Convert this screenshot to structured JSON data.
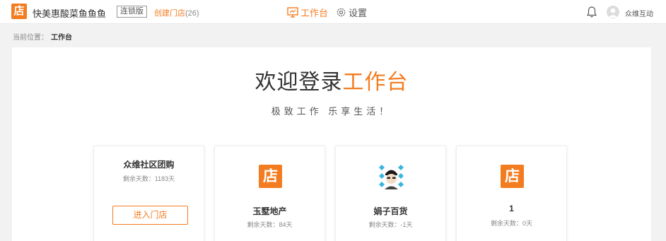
{
  "header": {
    "logo_char": "店",
    "brand_name": "快美惠酸菜鱼鱼鱼",
    "edition": "连锁版",
    "create_store_label": "创建门店",
    "create_store_count": "(26)",
    "nav": {
      "workbench": "工作台",
      "settings": "设置"
    },
    "username": "众维互动"
  },
  "breadcrumb": {
    "prefix": "当前位置：",
    "current": "工作台"
  },
  "main": {
    "welcome_prefix": "欢迎登录",
    "welcome_accent": "工作台",
    "slogan": "极致工作  乐享生活！",
    "stores": [
      {
        "name": "众维社区团购",
        "days": "剩余天数：1183天",
        "button": "进入门店"
      },
      {
        "name": "玉墅地产",
        "days": "剩余天数：84天",
        "icon": "store-icon"
      },
      {
        "name": "娟子百货",
        "days": "剩余天数：-1天",
        "icon": "photo-avatar"
      },
      {
        "name": "1",
        "days": "剩余天数：0天",
        "icon": "store-icon"
      }
    ]
  },
  "colors": {
    "accent": "#f47c20",
    "text": "#333333",
    "muted": "#888888",
    "background": "#f2f2f2"
  }
}
